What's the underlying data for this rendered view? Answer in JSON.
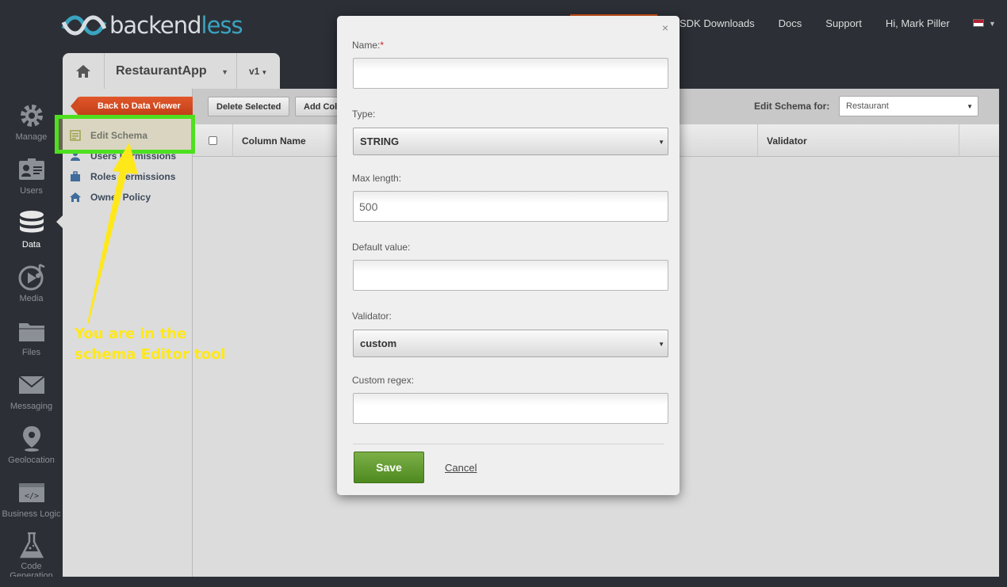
{
  "brand": {
    "logo_text_a": "backend",
    "logo_text_b": "less"
  },
  "topnav": {
    "sdk": "SDK Downloads",
    "docs": "Docs",
    "support": "Support",
    "user": "Hi, Mark Piller"
  },
  "apptabs": {
    "app_name": "RestaurantApp",
    "version": "v1"
  },
  "sidenav": [
    {
      "label": "Manage",
      "icon": "gear-icon"
    },
    {
      "label": "Users",
      "icon": "users-icon"
    },
    {
      "label": "Data",
      "icon": "database-icon"
    },
    {
      "label": "Media",
      "icon": "media-icon"
    },
    {
      "label": "Files",
      "icon": "folder-icon"
    },
    {
      "label": "Messaging",
      "icon": "envelope-icon"
    },
    {
      "label": "Geolocation",
      "icon": "map-pin-icon"
    },
    {
      "label": "Business Logic",
      "icon": "code-icon"
    },
    {
      "label": "Code Generation",
      "icon": "flask-icon"
    }
  ],
  "subnav": {
    "back": "Back to Data Viewer",
    "items": [
      {
        "label": "Edit Schema",
        "icon": "schema-icon"
      },
      {
        "label": "Users Permissions",
        "icon": "user-icon"
      },
      {
        "label": "Roles Permissions",
        "icon": "briefcase-icon"
      },
      {
        "label": "Owner Policy",
        "icon": "home-icon"
      }
    ]
  },
  "toolbar": {
    "delete_selected": "Delete Selected",
    "add_column": "Add Col",
    "schema_for_label": "Edit Schema for:",
    "schema_for_value": "Restaurant"
  },
  "table": {
    "columns": [
      "Column Name",
      "Validator"
    ]
  },
  "annotation": {
    "line1": "You are in the",
    "line2": "schema Editor tool"
  },
  "modal": {
    "close": "×",
    "name_label": "Name:",
    "required_mark": "*",
    "name_value": "",
    "type_label": "Type:",
    "type_value": "STRING",
    "maxlen_label": "Max length:",
    "maxlen_value": "500",
    "default_label": "Default value:",
    "default_value": "",
    "validator_label": "Validator:",
    "validator_value": "custom",
    "regex_label": "Custom regex:",
    "regex_value": "",
    "save": "Save",
    "cancel": "Cancel"
  },
  "colors": {
    "highlight_border": "#4ee01f",
    "annotation_text": "#ffe81a",
    "back_button": "#d04b20",
    "save_button": "#5e9a2c"
  }
}
